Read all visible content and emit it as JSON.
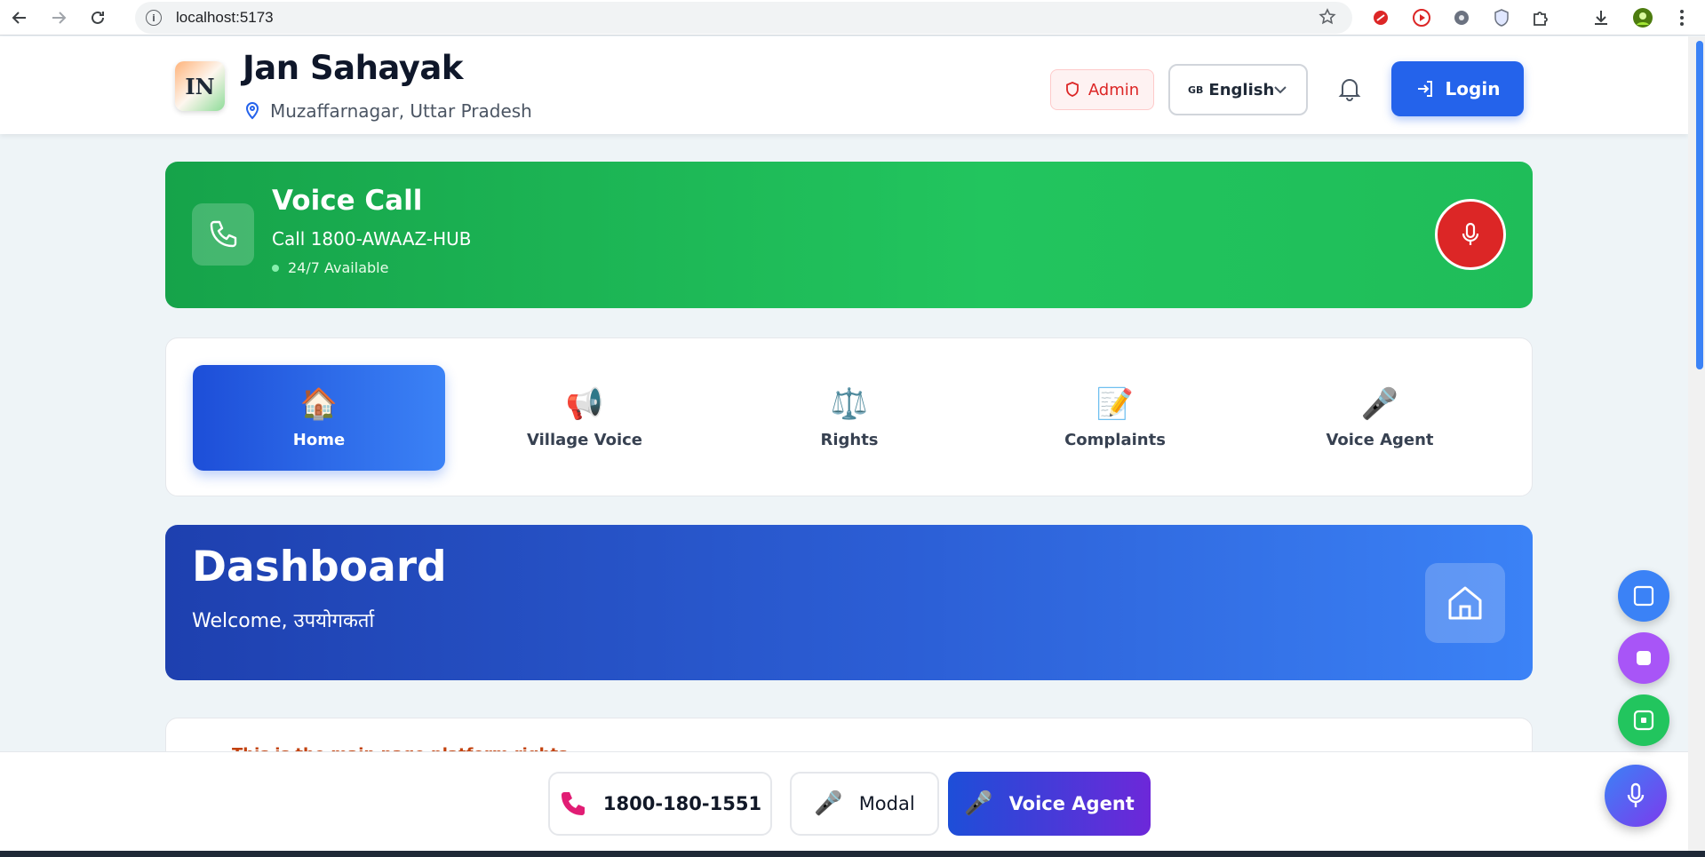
{
  "browser": {
    "url": "localhost:5173"
  },
  "header": {
    "logo_text": "IN",
    "title": "Jan Sahayak",
    "location": "Muzaffarnagar, Uttar Pradesh",
    "admin_label": "Admin",
    "language_flag": "GB",
    "language_label": "English",
    "login_label": "Login"
  },
  "voice_call": {
    "title": "Voice Call",
    "number_line": "Call 1800-AWAAZ-HUB",
    "status": "24/7 Available"
  },
  "nav": {
    "tabs": [
      {
        "emoji": "🏠",
        "label": "Home",
        "active": true
      },
      {
        "emoji": "📢",
        "label": "Village Voice",
        "active": false
      },
      {
        "emoji": "⚖️",
        "label": "Rights",
        "active": false
      },
      {
        "emoji": "📝",
        "label": "Complaints",
        "active": false
      },
      {
        "emoji": "🎤",
        "label": "Voice Agent",
        "active": false
      }
    ]
  },
  "dashboard": {
    "title": "Dashboard",
    "welcome": "Welcome, उपयोगकर्ता"
  },
  "next_section": {
    "peek_text": "This is the main page platform rights"
  },
  "bottom_bar": {
    "phone_label": "1800-180-1551",
    "modal_label": "Modal",
    "voice_agent_label": "Voice Agent"
  },
  "colors": {
    "primary": "#2463eb",
    "success": "#22c55e",
    "danger": "#dc2626",
    "purple": "#7c3aed"
  }
}
